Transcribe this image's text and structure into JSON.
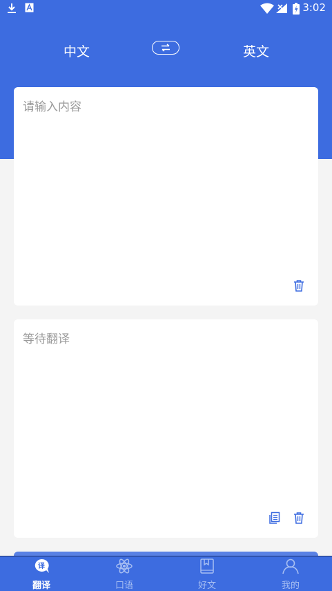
{
  "status_bar": {
    "time": "3:02",
    "icons": [
      "download-icon",
      "notification-icon",
      "wifi-icon",
      "signal-icon",
      "battery-icon"
    ]
  },
  "colors": {
    "primary": "#3d6ce0",
    "background": "#f4f4f4",
    "card": "#ffffff",
    "placeholder": "#9a9a9a",
    "icon": "#3d6ce0"
  },
  "language_bar": {
    "source_language": "中文",
    "target_language": "英文",
    "swap_icon": "swap-arrows-icon"
  },
  "input_card": {
    "placeholder": "请输入内容",
    "actions": [
      "trash-icon"
    ]
  },
  "output_card": {
    "placeholder": "等待翻译",
    "actions": [
      "copy-icon",
      "trash-icon"
    ]
  },
  "bottom_nav": {
    "items": [
      {
        "label": "翻译",
        "icon": "translate-icon",
        "active": true
      },
      {
        "label": "口语",
        "icon": "atom-icon",
        "active": false
      },
      {
        "label": "好文",
        "icon": "book-icon",
        "active": false
      },
      {
        "label": "我的",
        "icon": "person-icon",
        "active": false
      }
    ]
  }
}
